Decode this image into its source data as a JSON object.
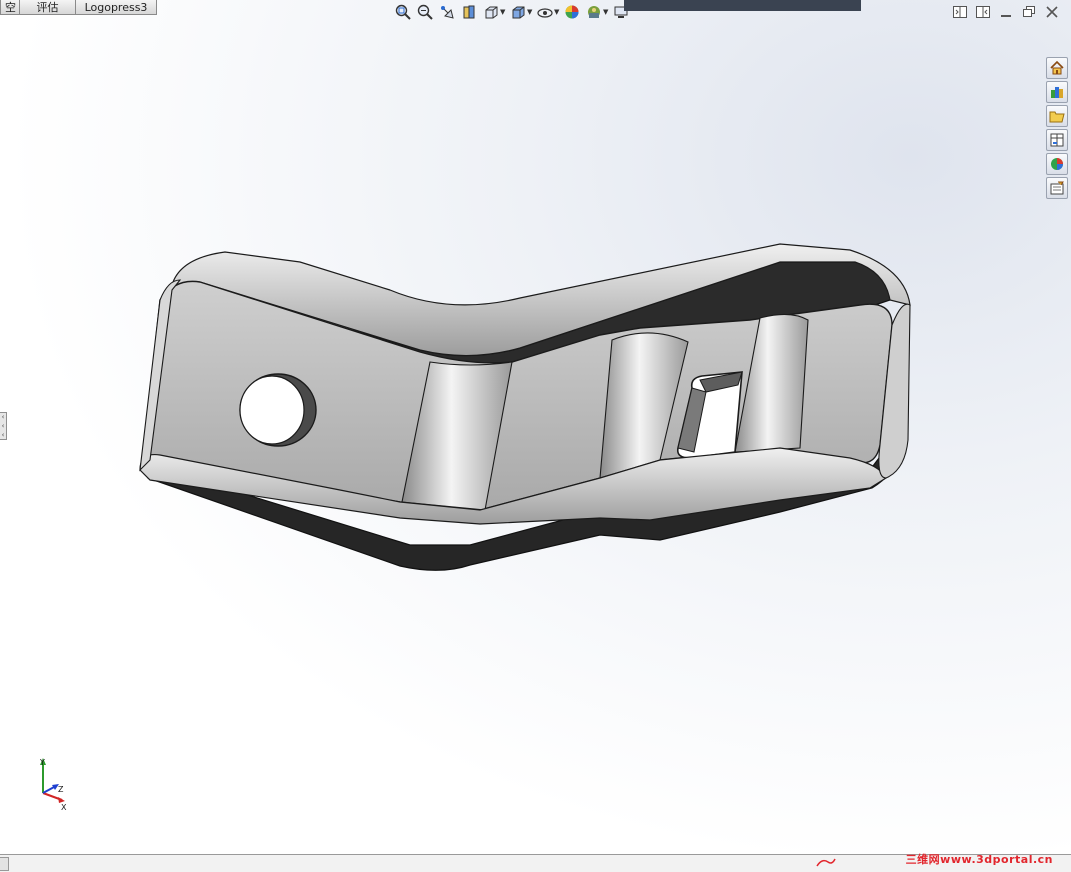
{
  "tabs": [
    {
      "label": "空"
    },
    {
      "label": "评估"
    },
    {
      "label": "Logopress3"
    }
  ],
  "view_toolbar": {
    "icons": [
      "zoom-to-fit-icon",
      "zoom-to-area-icon",
      "previous-view-icon",
      "section-view-icon",
      "view-orientation-icon",
      "display-style-icon",
      "hide-show-items-icon",
      "edit-appearance-icon",
      "apply-scene-icon",
      "view-settings-icon"
    ]
  },
  "window_controls": [
    "tile-left-icon",
    "tile-right-icon",
    "minimize-icon",
    "restore-icon",
    "close-icon"
  ],
  "task_pane": {
    "buttons": [
      "home-icon",
      "design-library-icon",
      "file-explorer-icon",
      "view-palette-icon",
      "appearances-icon",
      "custom-properties-icon"
    ]
  },
  "triad": {
    "x_label": "X",
    "y_label": "Y",
    "z_label": "Z"
  },
  "watermark": {
    "text": "三维网www.3dportal.cn"
  },
  "colors": {
    "part_face": "#b9b9b9",
    "part_dark": "#2a2a2a",
    "edge": "#1b1b1b",
    "watermark": "#e2262d"
  }
}
